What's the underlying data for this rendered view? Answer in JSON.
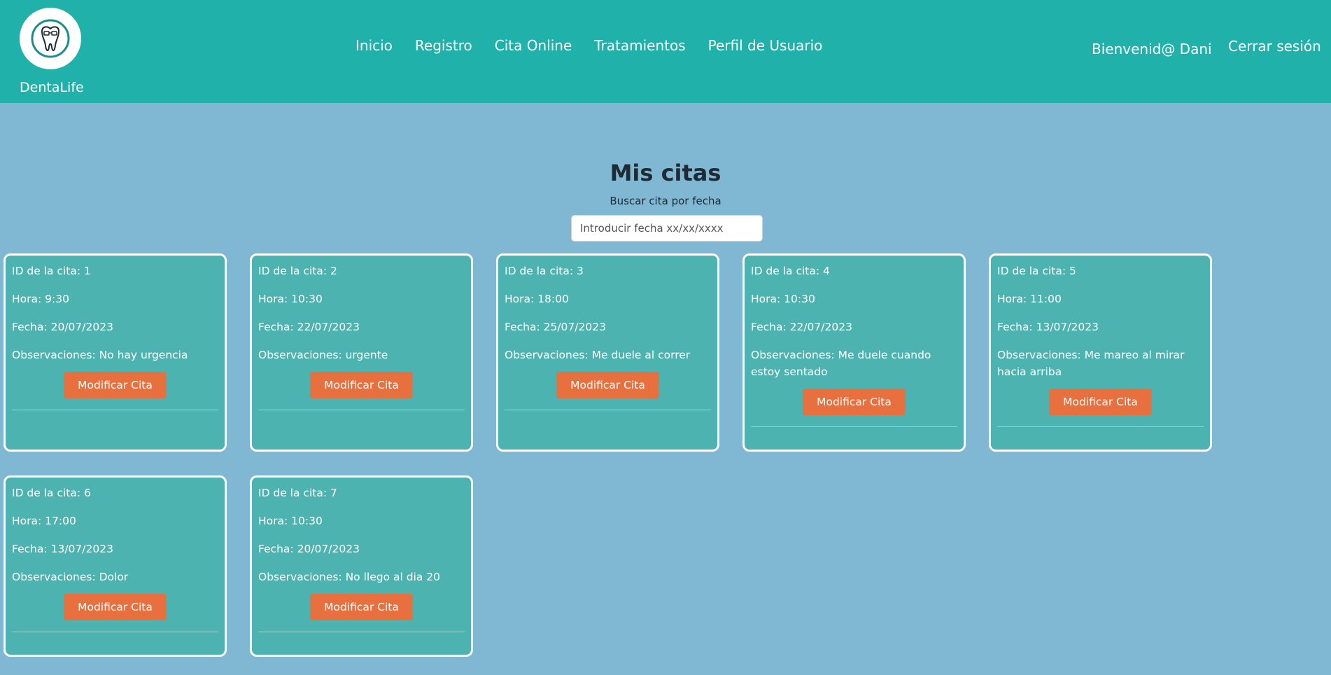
{
  "navbar": {
    "brand": "DentaLife",
    "links": [
      "Inicio",
      "Registro",
      "Cita Online",
      "Tratamientos",
      "Perfil de Usuario"
    ],
    "welcome": "Bienvenid@ Dani",
    "logout": "Cerrar sesión"
  },
  "main": {
    "title": "Mis citas",
    "search_label": "Buscar cita por fecha",
    "search_placeholder": "Introducir fecha xx/xx/xxxx"
  },
  "cards": [
    {
      "id": "ID de la cita: 1",
      "hora": "Hora: 9:30",
      "fecha": "Fecha: 20/07/2023",
      "obs": "Observaciones: No hay urgencia",
      "button": "Modificar Cita"
    },
    {
      "id": "ID de la cita: 2",
      "hora": "Hora: 10:30",
      "fecha": "Fecha: 22/07/2023",
      "obs": "Observaciones: urgente",
      "button": "Modificar Cita"
    },
    {
      "id": "ID de la cita: 3",
      "hora": "Hora: 18:00",
      "fecha": "Fecha: 25/07/2023",
      "obs": "Observaciones: Me duele al correr",
      "button": "Modificar Cita"
    },
    {
      "id": "ID de la cita: 4",
      "hora": "Hora: 10:30",
      "fecha": "Fecha: 22/07/2023",
      "obs": "Observaciones: Me duele cuando estoy sentado",
      "button": "Modificar Cita"
    },
    {
      "id": "ID de la cita: 5",
      "hora": "Hora: 11:00",
      "fecha": "Fecha: 13/07/2023",
      "obs": "Observaciones: Me mareo al mirar hacia arriba",
      "button": "Modificar Cita"
    },
    {
      "id": "ID de la cita: 6",
      "hora": "Hora: 17:00",
      "fecha": "Fecha: 13/07/2023",
      "obs": "Observaciones: Dolor",
      "button": "Modificar Cita"
    },
    {
      "id": "ID de la cita: 7",
      "hora": "Hora: 10:30",
      "fecha": "Fecha: 20/07/2023",
      "obs": "Observaciones: No llego al dia 20",
      "button": "Modificar Cita"
    }
  ],
  "colors": {
    "navbar": "#20b2aa",
    "background": "#80b8d4",
    "card": "#4db3b0",
    "button": "#e8703f"
  },
  "icons": {
    "logo": "tooth-logo-icon"
  }
}
